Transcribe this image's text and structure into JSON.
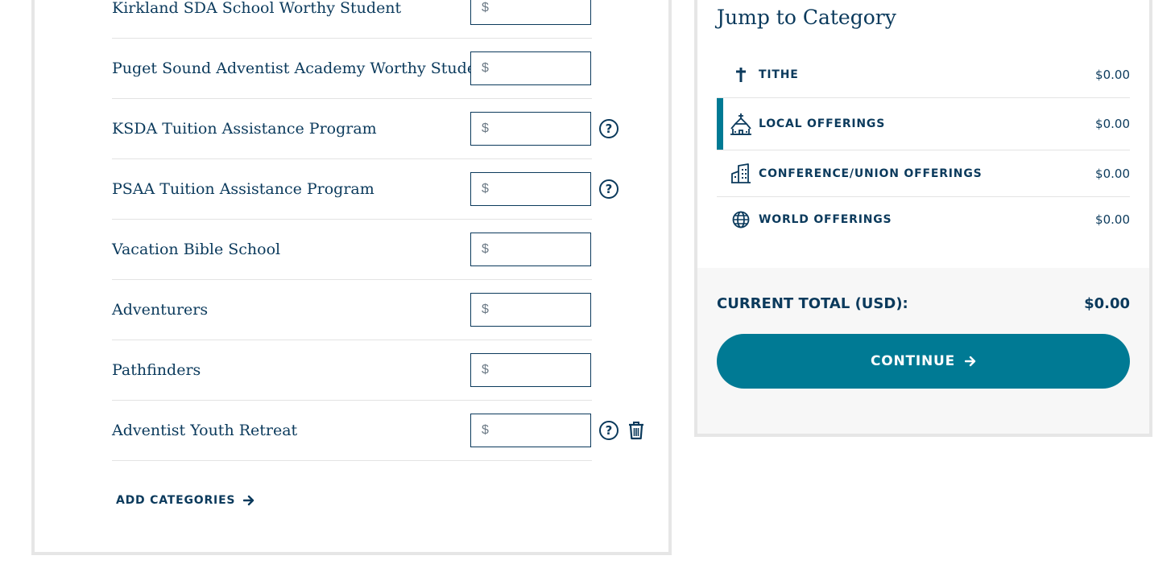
{
  "donation_rows": [
    {
      "label": "Kirkland SDA School Worthy Student",
      "currency": "$",
      "value": "",
      "help": false,
      "delete": false
    },
    {
      "label": "Puget Sound Adventist Academy Worthy Student",
      "currency": "$",
      "value": "",
      "help": false,
      "delete": false
    },
    {
      "label": "KSDA Tuition Assistance Program",
      "currency": "$",
      "value": "",
      "help": true,
      "delete": false
    },
    {
      "label": "PSAA Tuition Assistance Program",
      "currency": "$",
      "value": "",
      "help": true,
      "delete": false
    },
    {
      "label": "Vacation Bible School",
      "currency": "$",
      "value": "",
      "help": false,
      "delete": false
    },
    {
      "label": "Adventurers",
      "currency": "$",
      "value": "",
      "help": false,
      "delete": false
    },
    {
      "label": "Pathfinders",
      "currency": "$",
      "value": "",
      "help": false,
      "delete": false
    },
    {
      "label": "Adventist Youth Retreat",
      "currency": "$",
      "value": "",
      "help": true,
      "delete": true
    }
  ],
  "help_glyph": "?",
  "add_categories": {
    "label": "ADD CATEGORIES",
    "icon": "arrow-right-icon"
  },
  "jump": {
    "title": "Jump to Category",
    "items": [
      {
        "name": "TITHE",
        "amount": "$0.00",
        "icon": "cross-icon",
        "active": false
      },
      {
        "name": "LOCAL OFFERINGS",
        "amount": "$0.00",
        "icon": "church-icon",
        "active": true
      },
      {
        "name": "CONFERENCE/UNION OFFERINGS",
        "amount": "$0.00",
        "icon": "building-icon",
        "active": false
      },
      {
        "name": "WORLD OFFERINGS",
        "amount": "$0.00",
        "icon": "globe-icon",
        "active": false
      }
    ]
  },
  "total": {
    "label": "CURRENT TOTAL (USD):",
    "value": "$0.00"
  },
  "continue": {
    "label": "CONTINUE",
    "icon": "arrow-right-icon"
  },
  "colors": {
    "navy": "#0b3a5c",
    "teal": "#007a94",
    "border": "#e6e6e6"
  }
}
